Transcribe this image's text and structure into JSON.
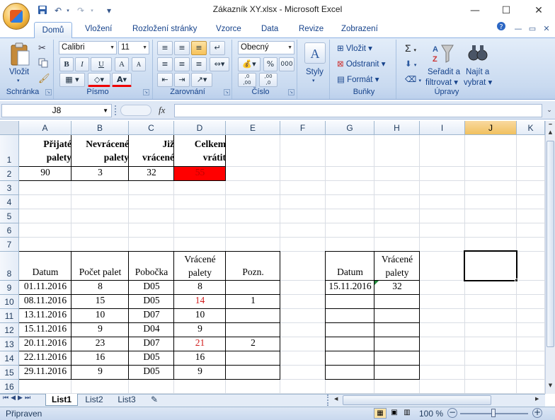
{
  "window": {
    "title": "Zákazník XY.xlsx - Microsoft Excel",
    "minimize": "—",
    "maximize": "☐",
    "close": "✕"
  },
  "qat": {
    "save_icon": "save-icon",
    "undo_icon": "undo-icon",
    "redo_icon": "redo-icon",
    "customize": "▾"
  },
  "tabs": [
    "Domů",
    "Vložení",
    "Rozložení stránky",
    "Vzorce",
    "Data",
    "Revize",
    "Zobrazení"
  ],
  "ribbon": {
    "groups": {
      "clipboard": "Schránka",
      "font": "Písmo",
      "alignment": "Zarovnání",
      "number": "Číslo",
      "styles": "",
      "cells": "Buňky",
      "editing": "Úpravy"
    },
    "paste": "Vložit",
    "font_name": "Calibri",
    "font_size": "11",
    "bold": "B",
    "italic": "I",
    "underline": "U",
    "grow": "A",
    "shrink": "A",
    "font_color": "A",
    "number_format": "Obecný",
    "percent": "%",
    "thousands": "000",
    "inc_dec": ",0\n,00",
    "dec_dec": ",00\n,0",
    "styles": "Styly",
    "insert": "Vložit",
    "delete": "Odstranit",
    "format": "Formát",
    "sum": "Σ",
    "sort_line1": "Seřadit a",
    "sort_line2": "filtrovat",
    "find_line1": "Najít a",
    "find_line2": "vybrat"
  },
  "formula_bar": {
    "name_box": "J8",
    "fx": "fx",
    "value": ""
  },
  "columns": [
    "A",
    "B",
    "C",
    "D",
    "E",
    "F",
    "G",
    "H",
    "I",
    "J",
    "K"
  ],
  "rows": [
    "1",
    "2",
    "3",
    "4",
    "5",
    "6",
    "7",
    "8",
    "9",
    "10",
    "11",
    "12",
    "13",
    "14",
    "15",
    "16"
  ],
  "summary": {
    "headers": [
      [
        "Přijaté",
        "palety"
      ],
      [
        "Nevrácené",
        "palety"
      ],
      [
        "Již",
        "vrácené"
      ],
      [
        "Celkem",
        "vrátit"
      ]
    ],
    "values": [
      "90",
      "3",
      "32",
      "55"
    ],
    "highlight_color": "#ff0000"
  },
  "log": {
    "headers": {
      "date": "Datum",
      "count": "Počet palet",
      "branch": "Pobočka",
      "returned1": "Vrácené",
      "returned2": "palety",
      "note": "Pozn."
    },
    "rows": [
      {
        "date": "01.11.2016",
        "count": "8",
        "branch": "D05",
        "returned": "8",
        "note": ""
      },
      {
        "date": "08.11.2016",
        "count": "15",
        "branch": "D05",
        "returned": "14",
        "note": "1"
      },
      {
        "date": "13.11.2016",
        "count": "10",
        "branch": "D07",
        "returned": "10",
        "note": ""
      },
      {
        "date": "15.11.2016",
        "count": "9",
        "branch": "D04",
        "returned": "9",
        "note": ""
      },
      {
        "date": "20.11.2016",
        "count": "23",
        "branch": "D07",
        "returned": "21",
        "note": "2"
      },
      {
        "date": "22.11.2016",
        "count": "16",
        "branch": "D05",
        "returned": "16",
        "note": ""
      },
      {
        "date": "29.11.2016",
        "count": "9",
        "branch": "D05",
        "returned": "9",
        "note": ""
      }
    ]
  },
  "returns": {
    "headers": {
      "date": "Datum",
      "returned1": "Vrácené",
      "returned2": "palety"
    },
    "rows": [
      {
        "date": "15.11.2016",
        "returned": "32"
      }
    ]
  },
  "sheets": [
    "List1",
    "List2",
    "List3"
  ],
  "status": {
    "ready": "Připraven",
    "zoom": "100 %"
  }
}
